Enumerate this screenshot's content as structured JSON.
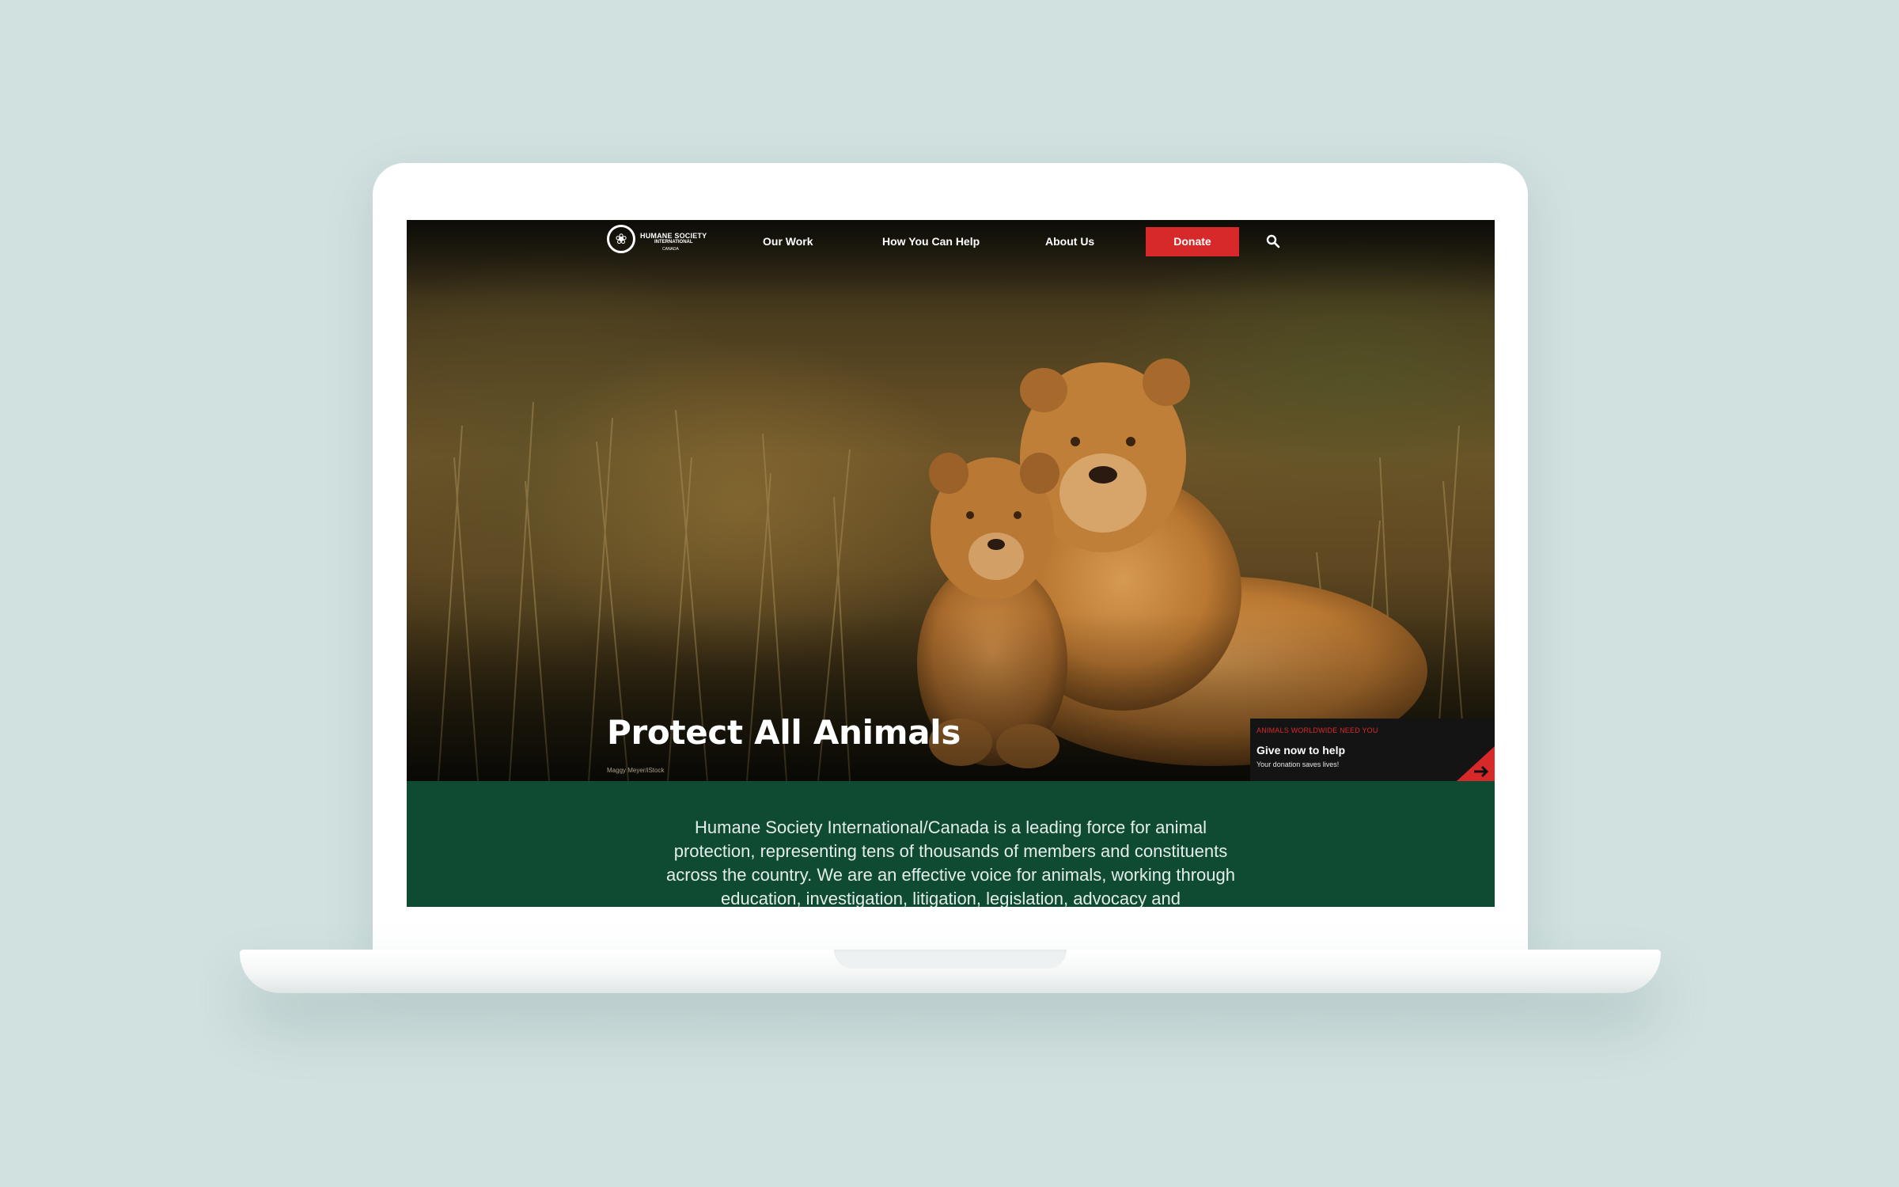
{
  "brand": {
    "line1": "HUMANE SOCIETY",
    "line2": "INTERNATIONAL",
    "line3": "CANADA"
  },
  "nav": {
    "items": [
      {
        "label": "Our Work"
      },
      {
        "label": "How You Can Help"
      },
      {
        "label": "About Us"
      }
    ],
    "donate_label": "Donate",
    "search_icon": "search-icon"
  },
  "hero": {
    "title": "Protect All Animals",
    "photo_credit": "Maggy Meyer/iStock"
  },
  "promo": {
    "kicker": "ANIMALS WORLDWIDE NEED YOU",
    "title": "Give now to help",
    "subtitle": "Your donation saves lives!",
    "icon": "arrow-right-icon"
  },
  "intro": {
    "text": "Humane Society International/Canada is a leading force for animal protection, representing tens of thousands of members and constituents across the country. We are an effective voice for animals, working through education, investigation, litigation, legislation, advocacy and"
  },
  "colors": {
    "accent_red": "#d8292a",
    "intro_green": "#0f4a32",
    "backdrop": "#d1e1e0"
  }
}
